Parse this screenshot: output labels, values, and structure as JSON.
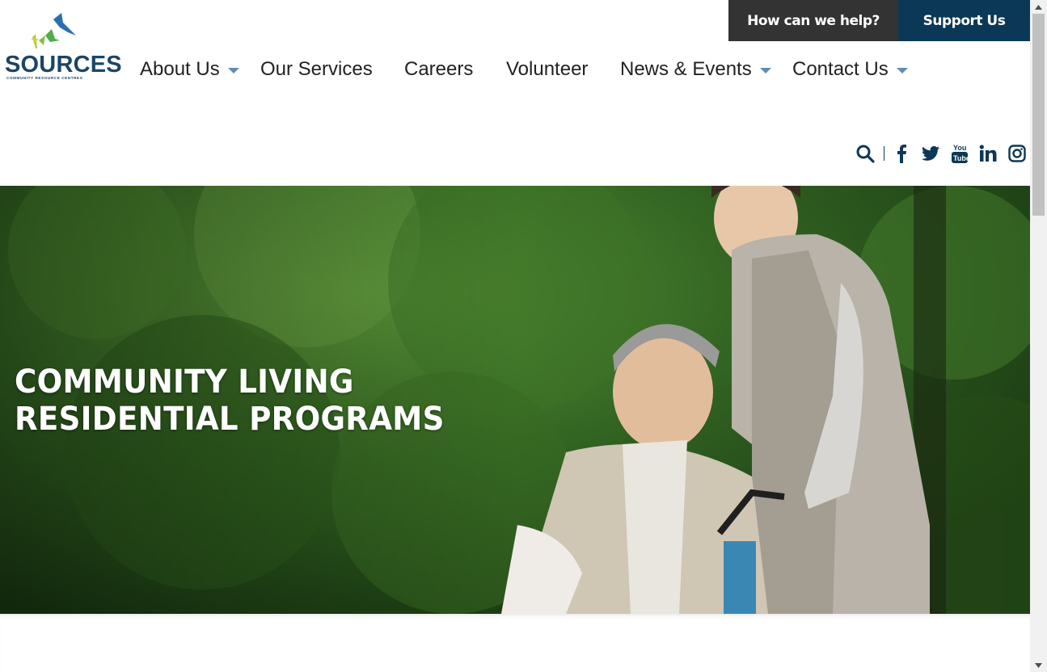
{
  "logo": {
    "word": "SOURCES",
    "tagline": "COMMUNITY RESOURCE CENTRES"
  },
  "top_buttons": {
    "help": "How can we help?",
    "support": "Support Us"
  },
  "nav": [
    {
      "label": "About Us",
      "has_dropdown": true
    },
    {
      "label": "Our Services",
      "has_dropdown": false
    },
    {
      "label": "Careers",
      "has_dropdown": false
    },
    {
      "label": "Volunteer",
      "has_dropdown": false
    },
    {
      "label": "News & Events",
      "has_dropdown": true
    },
    {
      "label": "Contact Us",
      "has_dropdown": true
    }
  ],
  "social_icons": [
    "search-icon",
    "facebook-icon",
    "twitter-icon",
    "youtube-icon",
    "linkedin-icon",
    "instagram-icon"
  ],
  "hero": {
    "title_line1": "COMMUNITY LIVING",
    "title_line2": "RESIDENTIAL PROGRAMS"
  },
  "colors": {
    "brand_navy": "#0c3857",
    "help_button": "#333333",
    "caret": "#5f8dae"
  }
}
